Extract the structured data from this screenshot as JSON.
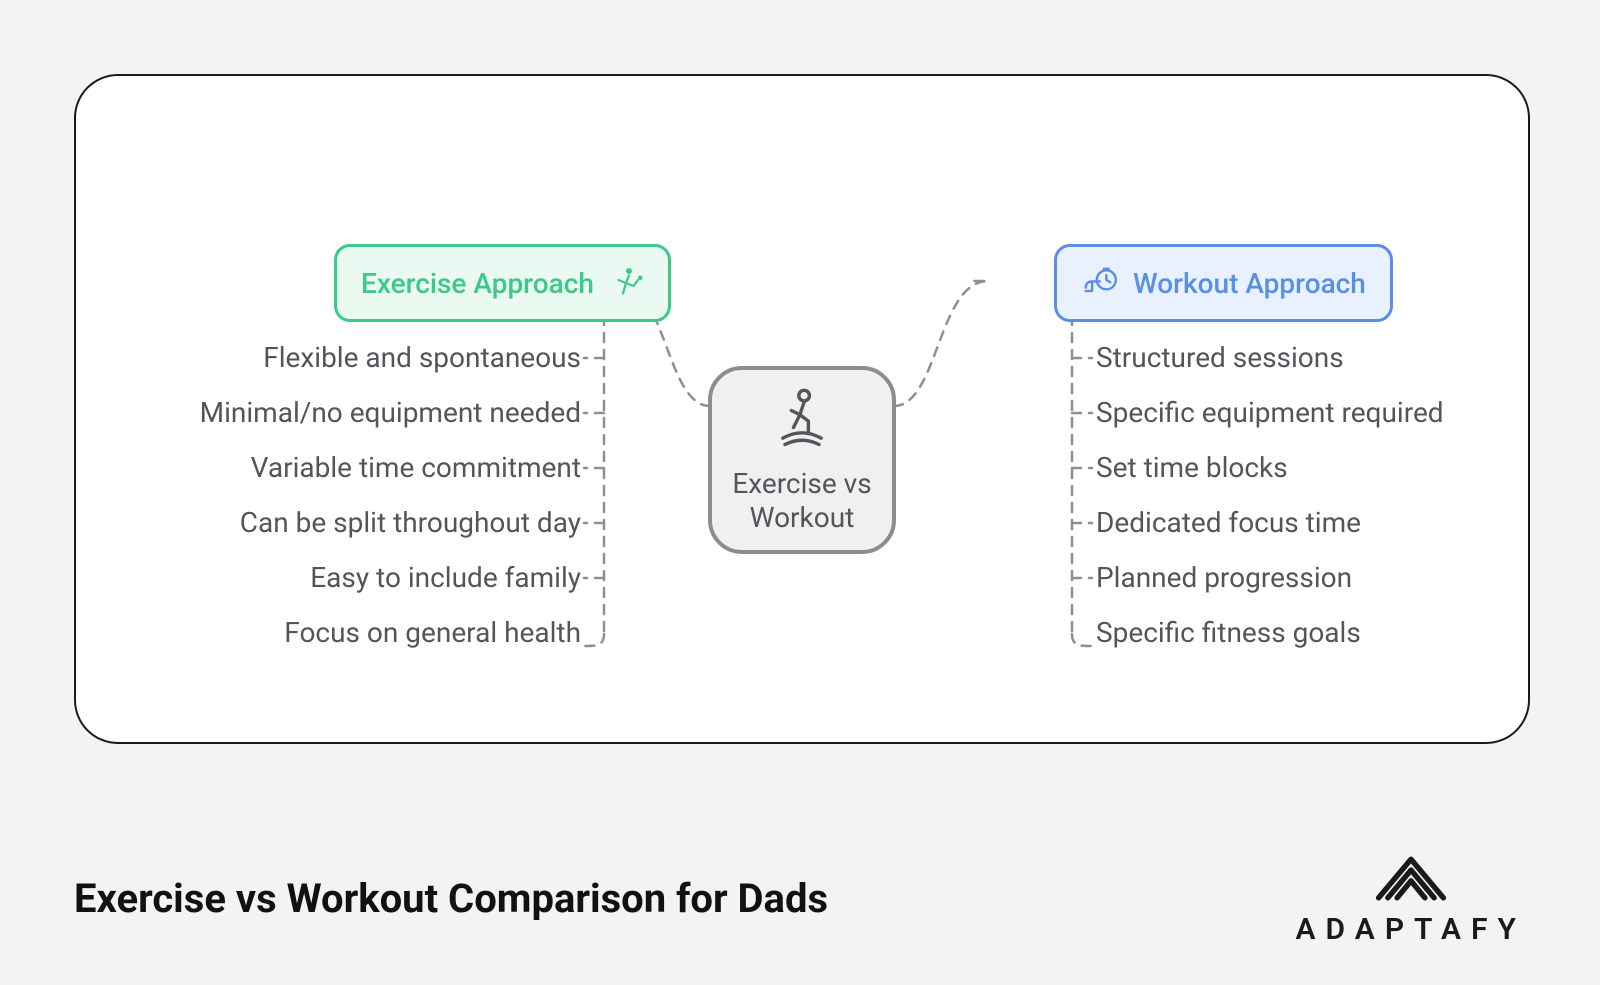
{
  "diagram": {
    "center": {
      "label_line1": "Exercise vs",
      "label_line2": "Workout",
      "icon": "person-cycling-icon"
    },
    "exercise": {
      "title": "Exercise Approach",
      "icon": "martial-arts-icon",
      "color_border": "#3cc98a",
      "color_fill": "#eaf9f1",
      "items": [
        "Flexible and spontaneous",
        "Minimal/no equipment needed",
        "Variable time commitment",
        "Can be split throughout day",
        "Easy to include family",
        "Focus on general health"
      ]
    },
    "workout": {
      "title": "Workout Approach",
      "icon": "stopwatch-hand-icon",
      "color_border": "#5a8fe6",
      "color_fill": "#e8f1fd",
      "items": [
        "Structured sessions",
        "Specific equipment required",
        "Set time blocks",
        "Dedicated focus time",
        "Planned progression",
        "Specific fitness goals"
      ]
    }
  },
  "caption": "Exercise vs Workout Comparison for Dads",
  "brand": {
    "name": "ADAPTAFY"
  }
}
